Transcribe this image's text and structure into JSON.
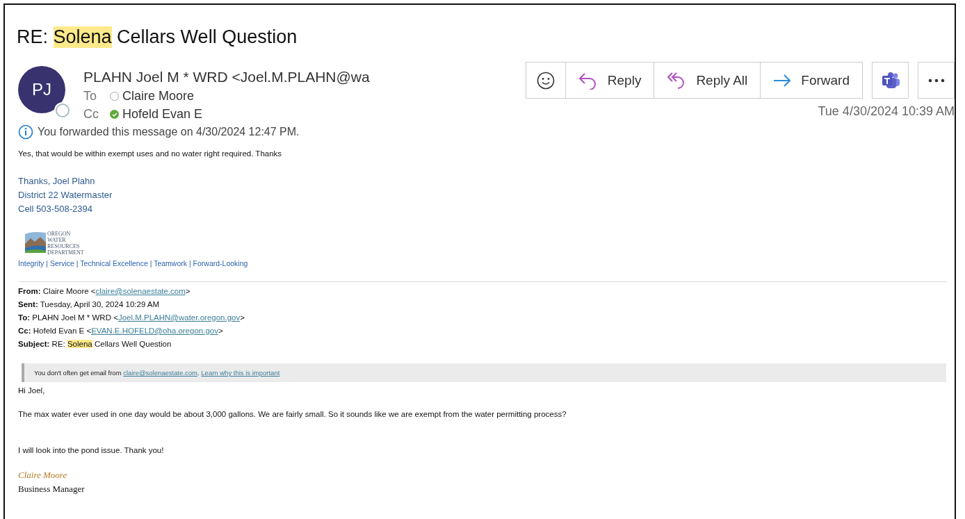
{
  "subject": [
    {
      "text": "RE: ",
      "highlighted": false
    },
    {
      "text": "Solena",
      "highlighted": true
    },
    {
      "text": " Cellars Well Question",
      "highlighted": false
    }
  ],
  "sender": {
    "initials": "PJ",
    "name": "PLAHN Joel M * WRD <Joel.M.PLAHN@wa"
  },
  "recipients": [
    {
      "label": "To",
      "name": "Claire Moore",
      "available": false
    },
    {
      "label": "Cc",
      "name": "Hofeld Evan E",
      "available": true
    }
  ],
  "actions": [
    {
      "kind": "emoji"
    },
    {
      "kind": "reply",
      "label": "Reply"
    },
    {
      "kind": "reply_all",
      "label": "Reply All"
    },
    {
      "kind": "forward",
      "label": "Forward"
    }
  ],
  "date": "Tue 4/30/2024 10:39 AM",
  "info": "You forwarded this message on 4/30/2024 12:47 PM.",
  "reply_text": "Yes, that would be within exempt uses and no water right required. Thanks",
  "signature": [
    "Thanks, Joel Plahn",
    "District 22 Watermaster",
    "Cell 503-508-2394"
  ],
  "logo_text": [
    "OREGON",
    "WATER",
    "RESOURCES",
    "DEPARTMENT"
  ],
  "values_line": "Integrity | Service | Technical Excellence | Teamwork | Forward-Looking",
  "forwarded_header": [
    {
      "label": "From:",
      "parts": [
        {
          "text": "Claire Moore <",
          "kind": "plain"
        },
        {
          "text": "claire@solenaestate.com",
          "kind": "link"
        },
        {
          "text": ">",
          "kind": "plain"
        }
      ]
    },
    {
      "label": "Sent:",
      "parts": [
        {
          "text": "Tuesday, April 30, 2024 10:29 AM",
          "kind": "plain"
        }
      ]
    },
    {
      "label": "To:",
      "parts": [
        {
          "text": "PLAHN Joel M * WRD <",
          "kind": "plain"
        },
        {
          "text": "Joel.M.PLAHN@water.oregon.gov",
          "kind": "link"
        },
        {
          "text": ">",
          "kind": "plain"
        }
      ]
    },
    {
      "label": "Cc:",
      "parts": [
        {
          "text": "Hofeld Evan E <",
          "kind": "plain"
        },
        {
          "text": "EVAN.E.HOFELD@oha.oregon.gov",
          "kind": "link"
        },
        {
          "text": ">",
          "kind": "plain"
        }
      ]
    },
    {
      "label": "Subject:",
      "parts": [
        {
          "text": "RE: ",
          "kind": "plain"
        },
        {
          "text": "Solena",
          "kind": "highlight"
        },
        {
          "text": " Cellars Well Question",
          "kind": "plain"
        }
      ]
    }
  ],
  "notice": {
    "text": "You don't often get email from ",
    "link": "claire@solenaestate.com",
    "after": ".",
    "learn_link": "Learn why this is important"
  },
  "message": [
    "Hi Joel,",
    "The max water ever used in one day would be about 3,000 gallons. We are fairly small. So it sounds like we are exempt from the water permitting process?",
    "I will look into the pond issue. Thank you!"
  ],
  "closing": {
    "name": "Claire Moore",
    "title": "Business Manager"
  }
}
